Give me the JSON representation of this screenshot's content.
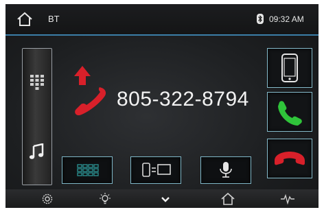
{
  "statusbar": {
    "home_icon": "home-icon",
    "source_label": "BT",
    "bluetooth_icon": "bluetooth-icon",
    "time": "09:32 AM"
  },
  "sidebar": {
    "items": [
      {
        "icon": "keypad-grid-icon"
      },
      {
        "icon": "music-note-icon"
      }
    ]
  },
  "call": {
    "direction_icon": "outgoing-call-icon",
    "number": "805-322-8794"
  },
  "controls": {
    "buttons": [
      {
        "icon": "keypad-icon"
      },
      {
        "icon": "phone-to-car-transfer-icon"
      },
      {
        "icon": "microphone-icon"
      }
    ]
  },
  "right_buttons": [
    {
      "icon": "mobile-phone-icon"
    },
    {
      "icon": "answer-call-icon"
    },
    {
      "icon": "hang-up-icon"
    }
  ],
  "bottombar": {
    "items": [
      {
        "icon": "settings-gear-icon"
      },
      {
        "icon": "brightness-bulb-icon"
      },
      {
        "icon": "chevron-down-icon"
      },
      {
        "icon": "home-icon"
      },
      {
        "icon": "audio-waveform-icon"
      }
    ]
  },
  "colors": {
    "accent": "#3b7fa8",
    "answer_green": "#2fc43a",
    "hangup_red": "#d8202a",
    "keypad_teal": "#2a8c8c"
  }
}
